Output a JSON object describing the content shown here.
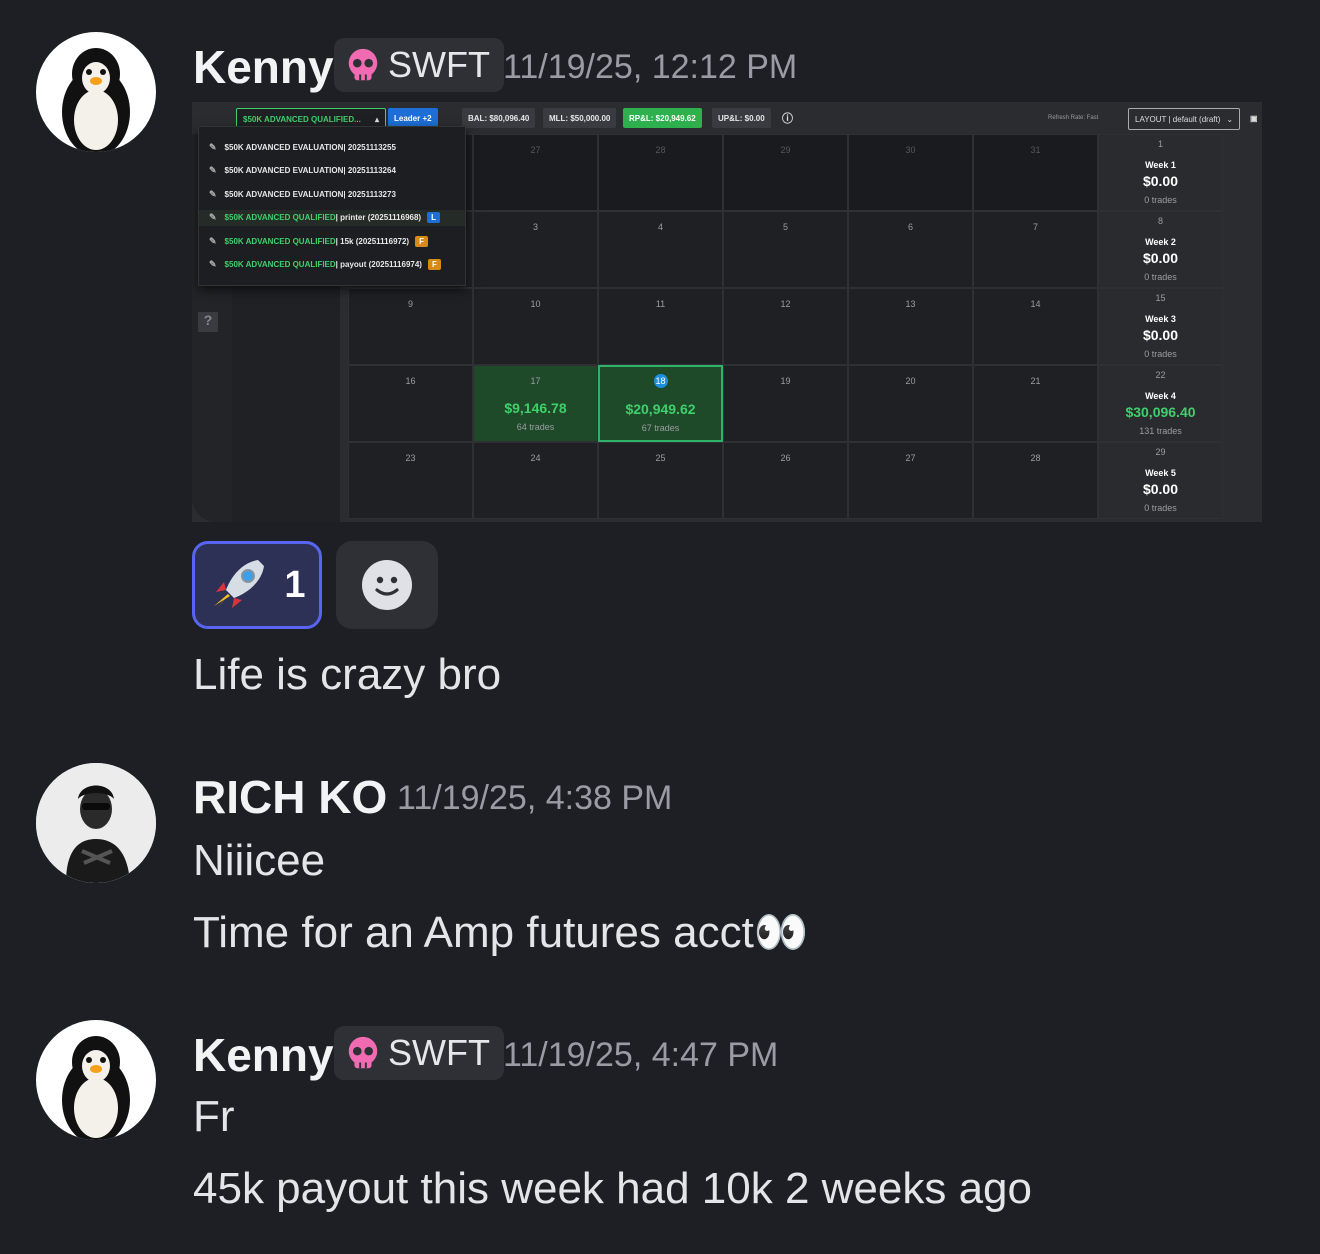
{
  "messages": [
    {
      "username": "Kenny",
      "tag": "SWFT",
      "timestamp": "11/19/25, 12:12 PM",
      "text": "Life is crazy bro"
    },
    {
      "username": "RICH KO",
      "timestamp": "11/19/25, 4:38 PM",
      "lines": [
        "Niiicee",
        "Time for an Amp futures acct👀"
      ]
    },
    {
      "username": "Kenny",
      "tag": "SWFT",
      "timestamp": "11/19/25, 4:47 PM",
      "lines": [
        "Fr",
        "45k payout this week had 10k 2 weeks ago"
      ]
    }
  ],
  "reactions": [
    {
      "emoji": "🚀",
      "count": "1"
    },
    {
      "emoji": "add-reaction-icon",
      "count": ""
    }
  ],
  "embed": {
    "account_select": "$50K ADVANCED QUALIFIED...",
    "leader_btn": "Leader +2",
    "bal": "BAL: $80,096.40",
    "mll": "MLL: $50,000.00",
    "rpnl": "RP&L: $20,949.62",
    "upnl": "UP&L: $0.00",
    "refresh": "Refresh Rate: Fast",
    "layout": "LAYOUT | default (draft)",
    "dropdown": [
      {
        "name": "$50K ADVANCED EVALUATION",
        "id": "20251113255",
        "badge": ""
      },
      {
        "name": "$50K ADVANCED EVALUATION",
        "id": "20251113264",
        "badge": ""
      },
      {
        "name": "$50K ADVANCED EVALUATION",
        "id": "20251113273",
        "badge": ""
      },
      {
        "name": "$50K ADVANCED QUALIFIED",
        "id": "printer (20251116968)",
        "badge": "L",
        "badge_color": "#1d6fd6"
      },
      {
        "name": "$50K ADVANCED QUALIFIED",
        "id": "15k (20251116972)",
        "badge": "F",
        "badge_color": "#d88a14"
      },
      {
        "name": "$50K ADVANCED QUALIFIED",
        "id": "payout (20251116974)",
        "badge": "F",
        "badge_color": "#d88a14"
      }
    ],
    "weeks": [
      {
        "days": [
          "27",
          "28",
          "29",
          "30",
          "31"
        ],
        "label": "Week 1",
        "day": "1",
        "amount": "$0.00",
        "trades": "0 trades"
      },
      {
        "days": [
          "3",
          "4",
          "5",
          "6",
          "7"
        ],
        "label": "Week 2",
        "day": "8",
        "amount": "$0.00",
        "trades": "0 trades"
      },
      {
        "days": [
          "10",
          "11",
          "12",
          "13",
          "14"
        ],
        "first": "9",
        "label": "Week 3",
        "day": "15",
        "amount": "$0.00",
        "trades": "0 trades"
      },
      {
        "days": [
          "17",
          "18",
          "19",
          "20",
          "21"
        ],
        "first": "16",
        "label": "Week 4",
        "day": "22",
        "amount": "$30,096.40",
        "trades": "131 trades"
      },
      {
        "days": [
          "24",
          "25",
          "26",
          "27",
          "28"
        ],
        "first": "23",
        "label": "Week 5",
        "day": "29",
        "amount": "$0.00",
        "trades": "0 trades"
      }
    ],
    "trade_days": [
      {
        "day": "17",
        "amount": "$9,146.78",
        "trades": "64 trades"
      },
      {
        "day": "18",
        "amount": "$20,949.62",
        "trades": "67 trades"
      }
    ]
  }
}
